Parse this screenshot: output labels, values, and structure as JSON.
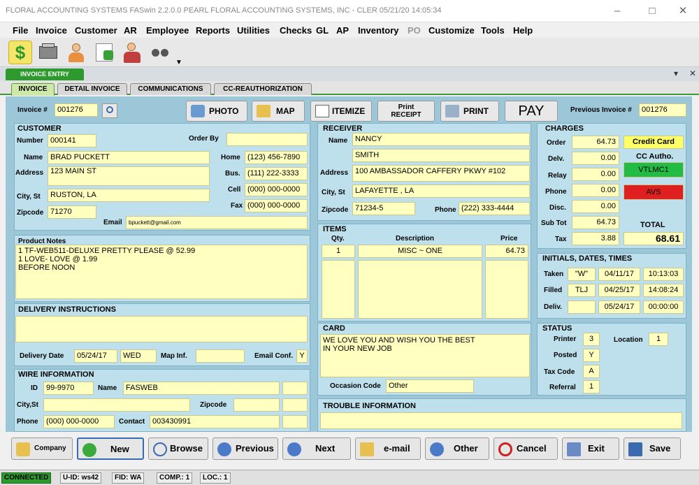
{
  "window": {
    "title": "FLORAL ACCOUNTING SYSTEMS  FASwin 2.2.0.0   PEARL   FLORAL ACCOUNTING SYSTEMS, INC - CLER   05/21/20  14:05:34"
  },
  "menu": [
    "File",
    "Invoice",
    "Customer",
    "AR",
    "Employee",
    "Reports",
    "Utilities",
    "Checks",
    "GL",
    "AP",
    "Inventory",
    "PO",
    "Customize",
    "Tools",
    "Help"
  ],
  "doc_tab": "INVOICE ENTRY",
  "tabs": [
    "INVOICE",
    "DETAIL INVOICE",
    "COMMUNICATIONS",
    "CC-REAUTHORIZATION"
  ],
  "top": {
    "invoice_label": "Invoice #",
    "invoice_no": "001276",
    "photo": "PHOTO",
    "map": "MAP",
    "itemize": "ITEMIZE",
    "print_receipt": "Print\nRECEIPT",
    "print": "PRINT",
    "pay": "PAY",
    "prev_label": "Previous Invoice #",
    "prev_no": "001276"
  },
  "customer": {
    "header": "CUSTOMER",
    "number_label": "Number",
    "number": "000141",
    "order_by_label": "Order By",
    "order_by": "",
    "name_label": "Name",
    "name": "BRAD PUCKETT",
    "address_label": "Address",
    "address": "123 MAIN ST",
    "city_label": "City, St",
    "city": "RUSTON, LA",
    "zip_label": "Zipcode",
    "zip": "71270",
    "home_label": "Home",
    "home": "(123) 456-7890",
    "bus_label": "Bus.",
    "bus": "(111) 222-3333",
    "cell_label": "Cell",
    "cell": "(000) 000-0000",
    "fax_label": "Fax",
    "fax": "(000) 000-0000",
    "email_label": "Email",
    "email": "bpuckett@gmail.com"
  },
  "product_notes": {
    "header": "Product Notes",
    "text": "1 TF-WEB511-DELUXE PRETTY PLEASE @ 52.99\n1 LOVE- LOVE @  1.99\nBEFORE NOON"
  },
  "delivery": {
    "header": "DELIVERY INSTRUCTIONS",
    "text": "",
    "date_label": "Delivery Date",
    "date": "05/24/17",
    "day": "WED",
    "map_label": "Map Inf.",
    "map": "",
    "email_conf_label": "Email Conf.",
    "email_conf": "Y"
  },
  "wire": {
    "header": "WIRE INFORMATION",
    "id_label": "ID",
    "id": "99-9970",
    "name_label": "Name",
    "name": "FASWEB",
    "city_label": "City,St",
    "city": "",
    "zip_label": "Zipcode",
    "zip": "",
    "phone_label": "Phone",
    "phone": "(000) 000-0000",
    "contact_label": "Contact",
    "contact": "003430991"
  },
  "receiver": {
    "header": "RECEIVER",
    "name_label": "Name",
    "first": "NANCY",
    "last": "SMITH",
    "address_label": "Address",
    "address": "100 AMBASSADOR CAFFERY PKWY #102",
    "city_label": "City, St",
    "city": "LAFAYETTE , LA",
    "zip_label": "Zipcode",
    "zip": "71234-5",
    "phone_label": "Phone",
    "phone": "(222) 333-4444"
  },
  "items": {
    "header": "ITEMS",
    "cols": [
      "Qty.",
      "Description",
      "Price"
    ],
    "rows": [
      {
        "qty": "1",
        "desc": "MISC ~ ONE",
        "price": "64.73"
      }
    ]
  },
  "card": {
    "header": "CARD",
    "text": "WE LOVE YOU AND WISH YOU THE BEST\nIN YOUR NEW JOB",
    "occasion_label": "Occasion Code",
    "occasion": "Other"
  },
  "trouble": {
    "header": "TROUBLE INFORMATION",
    "text": ""
  },
  "charges": {
    "header": "CHARGES",
    "order_label": "Order",
    "order": "64.73",
    "deliv_label": "Delv.",
    "deliv": "0.00",
    "relay_label": "Relay",
    "relay": "0.00",
    "phone_label": "Phone",
    "phone": "0.00",
    "disc_label": "Disc.",
    "disc": "0.00",
    "subtot_label": "Sub Tot",
    "subtot": "64.73",
    "tax_label": "Tax",
    "tax": "3.88",
    "credit_card": "Credit Card",
    "cc_auth_label": "CC Autho.",
    "cc_auth": "VTLMC1",
    "avs": "AVS",
    "total_label": "TOTAL",
    "total": "68.61"
  },
  "initials": {
    "header": "INITIALS, DATES, TIMES",
    "taken_label": "Taken",
    "taken_init": "\"W\"",
    "taken_date": "04/11/17",
    "taken_time": "10:13:03",
    "filled_label": "Filled",
    "filled_init": "TLJ",
    "filled_date": "04/25/17",
    "filled_time": "14:08:24",
    "deliv_label": "Deliv.",
    "deliv_init": "",
    "deliv_date": "05/24/17",
    "deliv_time": "00:00:00"
  },
  "status": {
    "header": "STATUS",
    "printer_label": "Printer",
    "printer": "3",
    "location_label": "Location",
    "location": "1",
    "posted_label": "Posted",
    "posted": "Y",
    "taxcode_label": "Tax Code",
    "taxcode": "A",
    "referral_label": "Referral",
    "referral": "1"
  },
  "buttons": {
    "company": "Company",
    "new": "New",
    "browse": "Browse",
    "previous": "Previous",
    "next": "Next",
    "email": "e-mail",
    "other": "Other",
    "cancel": "Cancel",
    "exit": "Exit",
    "save": "Save"
  },
  "statusbar": {
    "connected": "CONNECTED",
    "uid": "U-ID: ws42",
    "fid": "FID: WA",
    "comp": "COMP.: 1",
    "loc": "LOC.: 1"
  },
  "colors": {
    "panel": "#bde0ec",
    "field": "#ffffc0",
    "connected": "#2e9a2e",
    "cc_auth": "#22bb44",
    "avs": "#e02020",
    "credit_card": "#ffff66"
  }
}
